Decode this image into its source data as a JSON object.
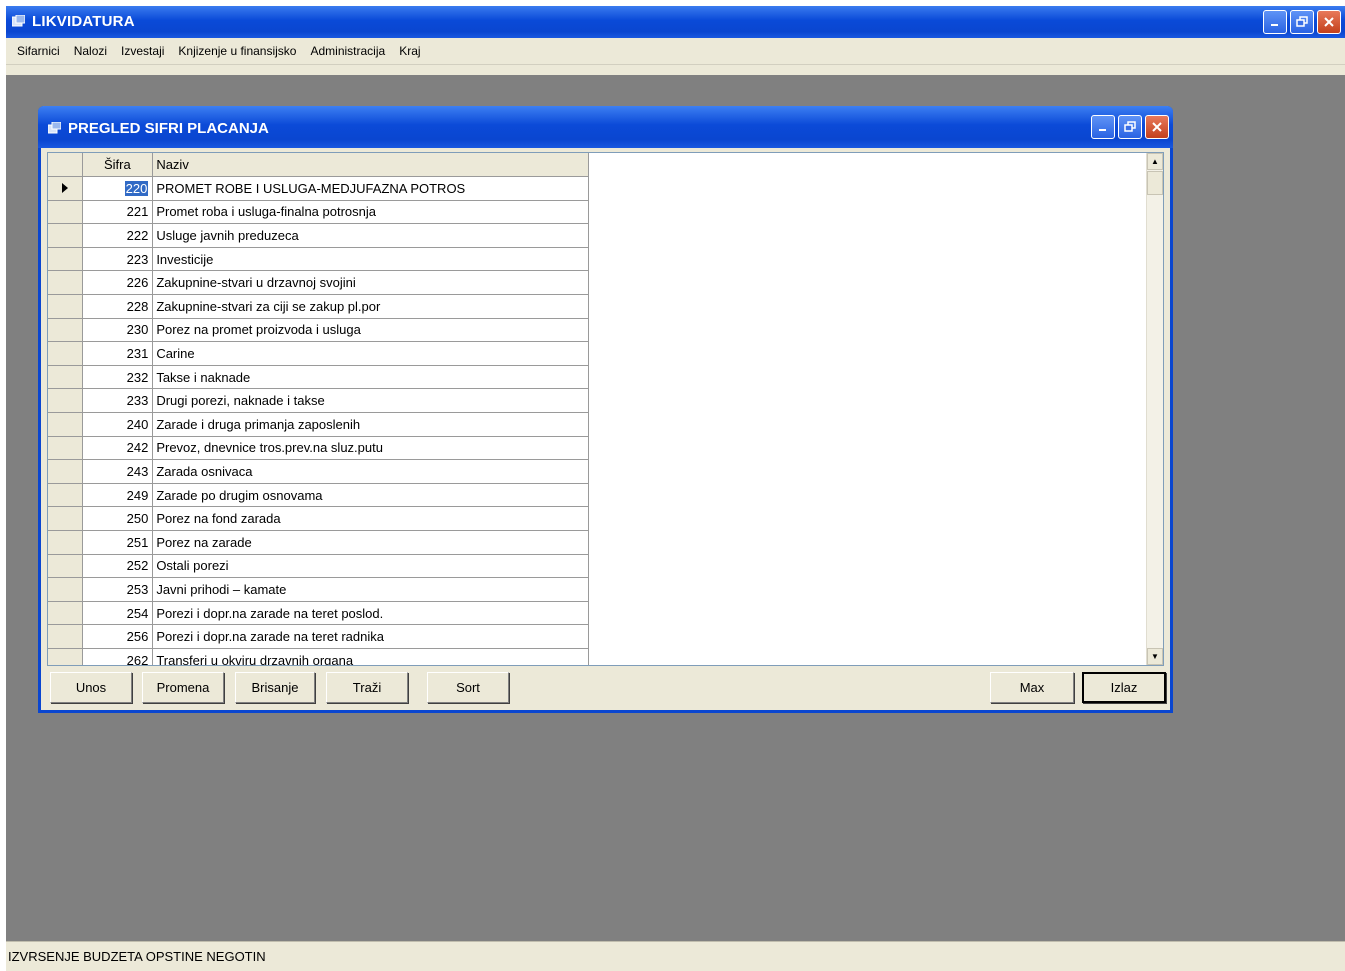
{
  "app": {
    "title": "LIKVIDATURA",
    "menu": [
      "Sifarnici",
      "Nalozi",
      "Izvestaji",
      "Knjizenje u finansijsko",
      "Administracija",
      "Kraj"
    ]
  },
  "dialog": {
    "title": "PREGLED SIFRI PLACANJA",
    "columns": {
      "code": "Šifra",
      "name": "Naziv"
    },
    "rows": [
      {
        "code": "220",
        "name": "PROMET ROBE I USLUGA-MEDJUFAZNA POTROS",
        "selected": true
      },
      {
        "code": "221",
        "name": "Promet roba i usluga-finalna potrosnja"
      },
      {
        "code": "222",
        "name": "Usluge javnih preduzeca"
      },
      {
        "code": "223",
        "name": "Investicije"
      },
      {
        "code": "226",
        "name": "Zakupnine-stvari u drzavnoj svojini"
      },
      {
        "code": "228",
        "name": "Zakupnine-stvari za ciji se zakup pl.por"
      },
      {
        "code": "230",
        "name": "Porez na promet proizvoda i usluga"
      },
      {
        "code": "231",
        "name": "Carine"
      },
      {
        "code": "232",
        "name": "Takse i naknade"
      },
      {
        "code": "233",
        "name": "Drugi porezi, naknade i takse"
      },
      {
        "code": "240",
        "name": "Zarade i druga primanja zaposlenih"
      },
      {
        "code": "242",
        "name": "Prevoz, dnevnice tros.prev.na sluz.putu"
      },
      {
        "code": "243",
        "name": "Zarada osnivaca"
      },
      {
        "code": "249",
        "name": "Zarade po drugim osnovama"
      },
      {
        "code": "250",
        "name": "Porez na fond zarada"
      },
      {
        "code": "251",
        "name": "Porez na zarade"
      },
      {
        "code": "252",
        "name": "Ostali porezi"
      },
      {
        "code": "253",
        "name": "Javni prihodi – kamate"
      },
      {
        "code": "254",
        "name": "Porezi i dopr.na zarade na teret poslod."
      },
      {
        "code": "256",
        "name": "Porezi i dopr.na zarade na teret radnika"
      },
      {
        "code": "262",
        "name": "Transferi u okviru drzavnih organa"
      }
    ],
    "buttons": {
      "unos": "Unos",
      "promena": "Promena",
      "brisanje": "Brisanje",
      "trazi": "Traži",
      "sort": "Sort",
      "max": "Max",
      "izlaz": "Izlaz"
    }
  },
  "statusbar": {
    "text": "IZVRSENJE BUDZETA OPSTINE NEGOTIN"
  },
  "icons": {
    "app": "app-icon",
    "dialog": "dialog-icon",
    "minimize": "minimize-icon",
    "restore": "restore-icon",
    "close": "close-icon",
    "row_pointer": "row-pointer-icon"
  },
  "colors": {
    "titlebar": "#0a46d0",
    "desktop": "#808080",
    "face": "#ece9d8",
    "selection": "#316ac5"
  }
}
